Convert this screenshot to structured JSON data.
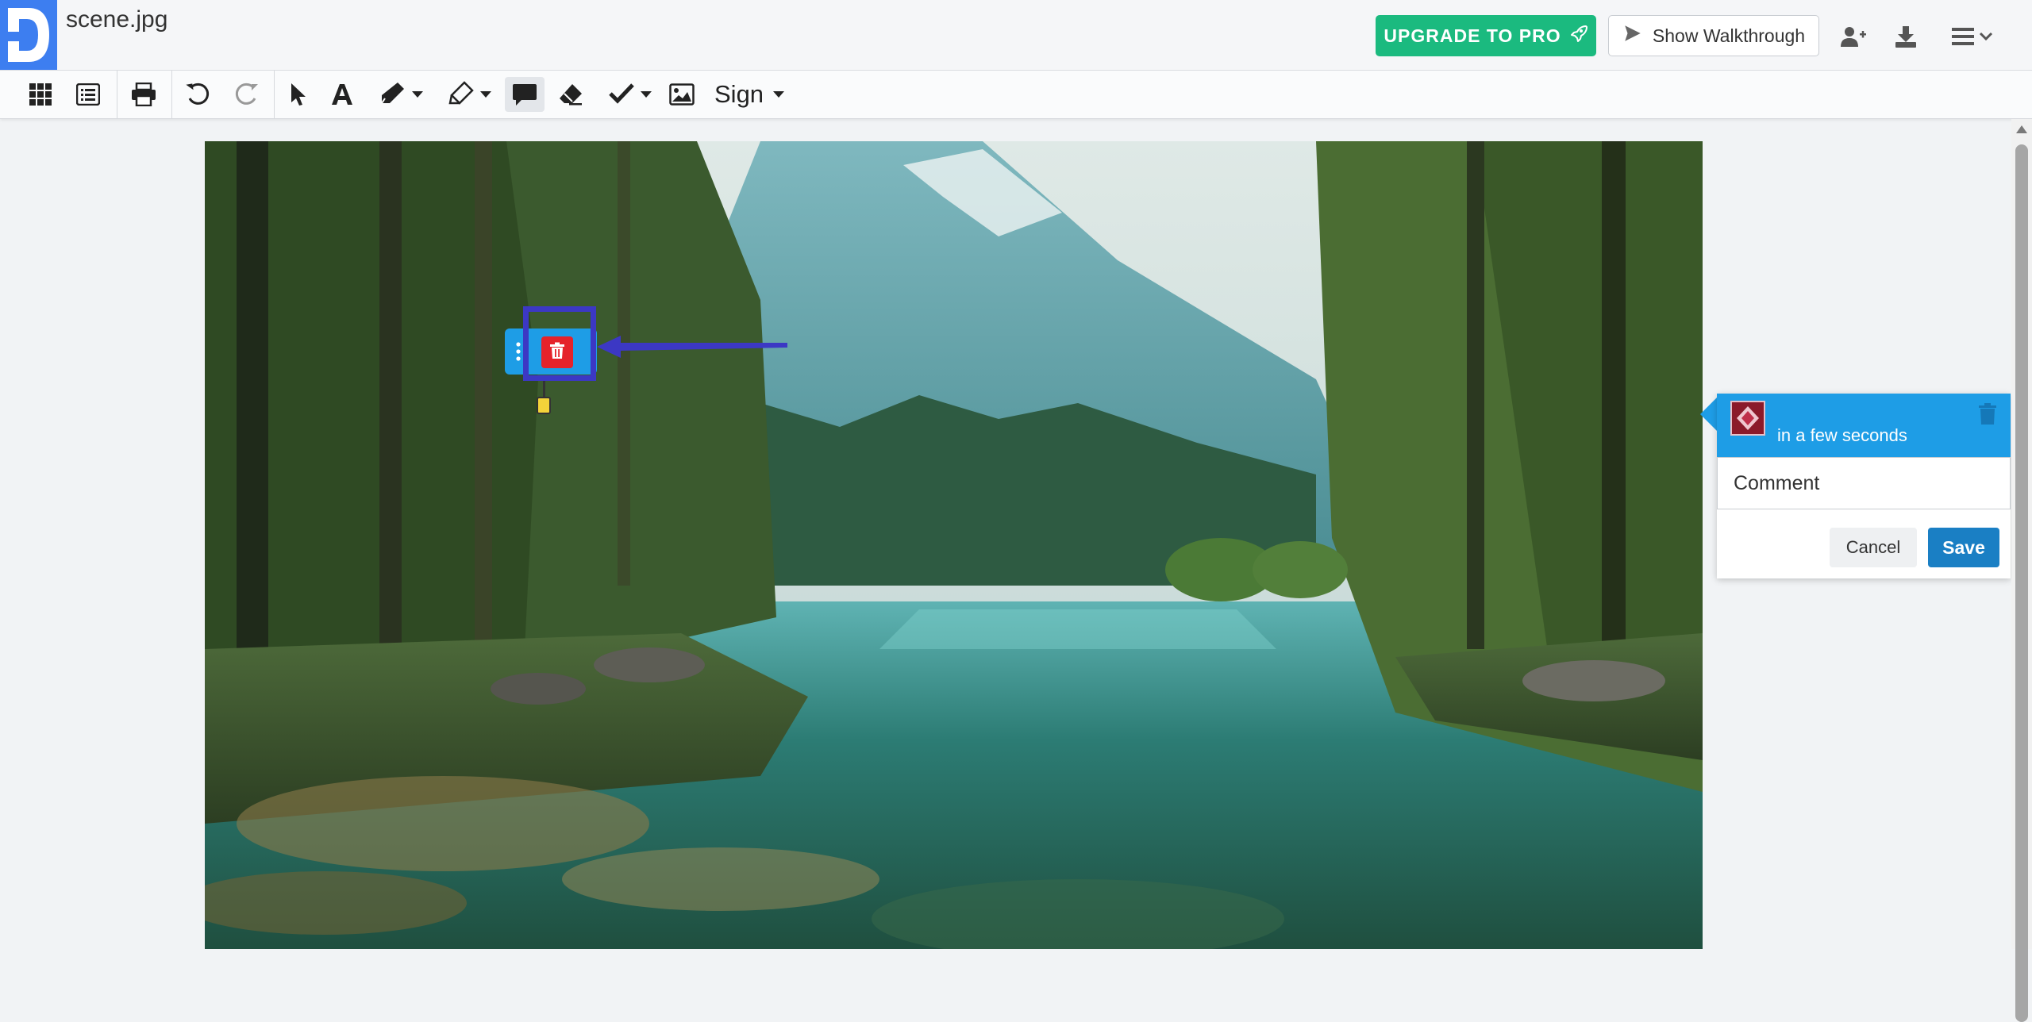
{
  "header": {
    "filename": "scene.jpg",
    "upgrade_label": "UPGRADE TO PRO",
    "walkthrough_label": "Show Walkthrough"
  },
  "toolbar": {
    "sign_label": "Sign",
    "tools": [
      "grid-icon",
      "list-icon",
      "print-icon",
      "undo-icon",
      "redo-icon",
      "pointer-icon",
      "text-icon",
      "pen-icon",
      "highlighter-icon",
      "comment-icon",
      "eraser-icon",
      "checkmark-icon",
      "image-icon"
    ]
  },
  "comment": {
    "time": "in a few seconds",
    "placeholder": "Comment",
    "cancel_label": "Cancel",
    "save_label": "Save"
  },
  "colors": {
    "accent": "#1e9de6",
    "pro_green": "#1bba7f",
    "delete_red": "#e5222a",
    "highlight": "#3c38c4",
    "save_blue": "#1a7fc4"
  }
}
